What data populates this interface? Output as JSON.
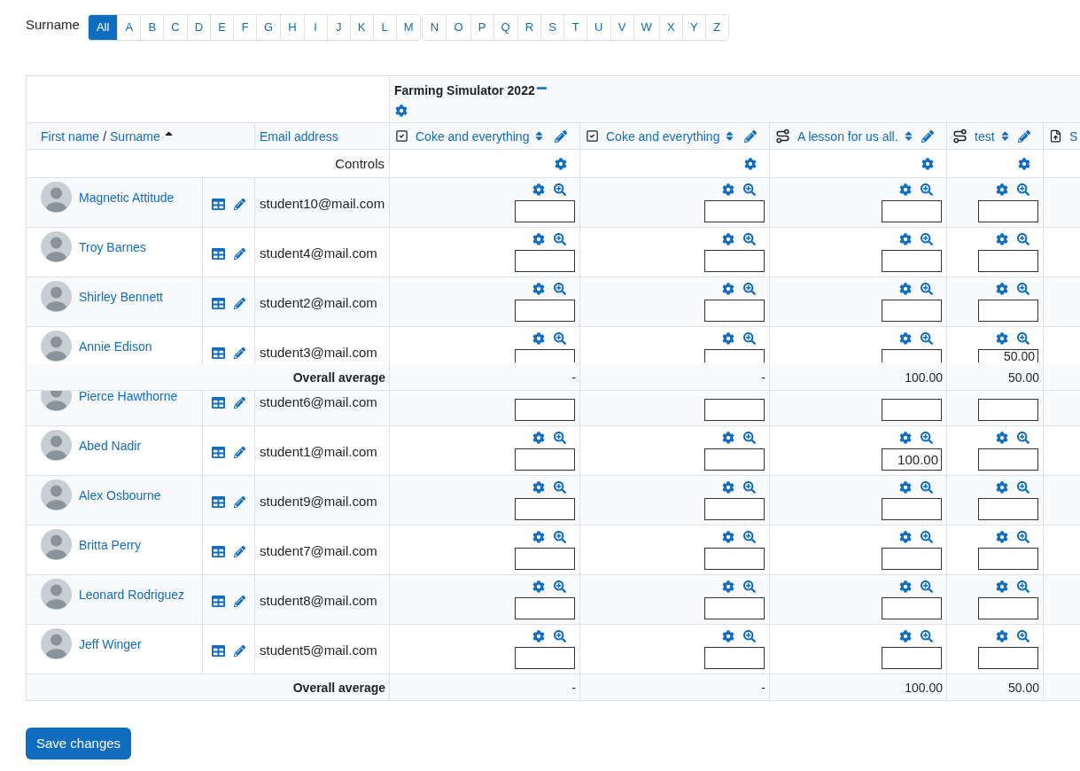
{
  "filter": {
    "label": "Surname",
    "groups": [
      [
        {
          "label": "All",
          "selected": true
        },
        {
          "label": "A",
          "selected": false
        },
        {
          "label": "B",
          "selected": false
        },
        {
          "label": "C",
          "selected": false
        },
        {
          "label": "D",
          "selected": false
        },
        {
          "label": "E",
          "selected": false
        },
        {
          "label": "F",
          "selected": false
        },
        {
          "label": "G",
          "selected": false
        },
        {
          "label": "H",
          "selected": false
        },
        {
          "label": "I",
          "selected": false
        },
        {
          "label": "J",
          "selected": false
        },
        {
          "label": "K",
          "selected": false
        },
        {
          "label": "L",
          "selected": false
        },
        {
          "label": "M",
          "selected": false
        }
      ],
      [
        {
          "label": "N",
          "selected": false
        },
        {
          "label": "O",
          "selected": false
        },
        {
          "label": "P",
          "selected": false
        },
        {
          "label": "Q",
          "selected": false
        },
        {
          "label": "R",
          "selected": false
        },
        {
          "label": "S",
          "selected": false
        },
        {
          "label": "T",
          "selected": false
        },
        {
          "label": "U",
          "selected": false
        },
        {
          "label": "V",
          "selected": false
        },
        {
          "label": "W",
          "selected": false
        },
        {
          "label": "X",
          "selected": false
        },
        {
          "label": "Y",
          "selected": false
        },
        {
          "label": "Z",
          "selected": false
        }
      ]
    ]
  },
  "table": {
    "category": "Farming Simulator 2022",
    "name_header": {
      "first": "First name",
      "separator": "/",
      "last": "Surname"
    },
    "email_header": "Email address",
    "controls_label": "Controls",
    "items": [
      {
        "kind": "checklist",
        "label": "Coke and everything"
      },
      {
        "kind": "checklist",
        "label": "Coke and everything"
      },
      {
        "kind": "lesson",
        "label": "A lesson for us all."
      },
      {
        "kind": "lesson",
        "label": "test"
      },
      {
        "kind": "assignment",
        "label": "S"
      }
    ],
    "rows": [
      {
        "name": "Magnetic Attitude",
        "email": "student10@mail.com",
        "grades": [
          {
            "kind": "input"
          },
          {
            "kind": "input"
          },
          {
            "kind": "input"
          },
          {
            "kind": "input"
          }
        ]
      },
      {
        "name": "Troy Barnes",
        "email": "student4@mail.com",
        "grades": [
          {
            "kind": "input"
          },
          {
            "kind": "input"
          },
          {
            "kind": "input"
          },
          {
            "kind": "input"
          }
        ]
      },
      {
        "name": "Shirley Bennett",
        "email": "student2@mail.com",
        "grades": [
          {
            "kind": "input"
          },
          {
            "kind": "input"
          },
          {
            "kind": "input"
          },
          {
            "kind": "input"
          }
        ]
      },
      {
        "name": "Annie Edison",
        "email": "student3@mail.com",
        "grades": [
          {
            "kind": "input"
          },
          {
            "kind": "input"
          },
          {
            "kind": "input"
          },
          {
            "kind": "input",
            "value": "50.00"
          }
        ]
      },
      {
        "name": "Pierce Hawthorne",
        "email": "student6@mail.com",
        "grades": [
          {
            "kind": "input"
          },
          {
            "kind": "input"
          },
          {
            "kind": "input"
          },
          {
            "kind": "input"
          }
        ]
      },
      {
        "name": "Abed Nadir",
        "email": "student1@mail.com",
        "grades": [
          {
            "kind": "input"
          },
          {
            "kind": "input"
          },
          {
            "kind": "input",
            "value": "100.00"
          },
          {
            "kind": "input"
          }
        ]
      },
      {
        "name": "Alex Osbourne",
        "email": "student9@mail.com",
        "grades": [
          {
            "kind": "input"
          },
          {
            "kind": "input"
          },
          {
            "kind": "input"
          },
          {
            "kind": "input"
          }
        ]
      },
      {
        "name": "Britta Perry",
        "email": "student7@mail.com",
        "grades": [
          {
            "kind": "input"
          },
          {
            "kind": "input"
          },
          {
            "kind": "input"
          },
          {
            "kind": "input"
          }
        ]
      },
      {
        "name": "Leonard Rodriguez",
        "email": "student8@mail.com",
        "grades": [
          {
            "kind": "input"
          },
          {
            "kind": "input"
          },
          {
            "kind": "input"
          },
          {
            "kind": "input"
          }
        ]
      },
      {
        "name": "Jeff Winger",
        "email": "student5@mail.com",
        "grades": [
          {
            "kind": "input"
          },
          {
            "kind": "input"
          },
          {
            "kind": "input"
          },
          {
            "kind": "input"
          }
        ]
      }
    ],
    "sticky_average": {
      "label": "Overall average",
      "values": [
        "-",
        "-",
        "100.00",
        "50.00"
      ]
    },
    "average": {
      "label": "Overall average",
      "values": [
        "-",
        "-",
        "100.00",
        "50.00"
      ]
    }
  },
  "save_button": "Save changes"
}
